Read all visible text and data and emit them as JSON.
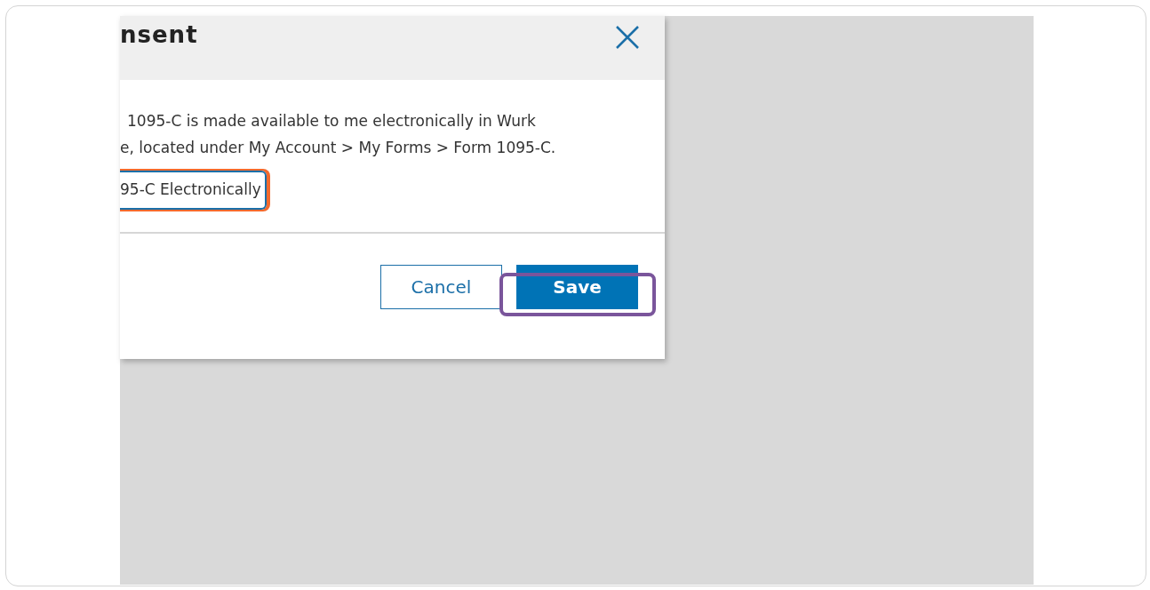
{
  "dialog": {
    "title": "nsent",
    "body_lines": [
      "1095-C is made available to me electronically in Wurk",
      "e, located under My Account > My Forms > Form 1095-C."
    ],
    "consent_button": {
      "label": "95-C Electronically",
      "focused": true
    },
    "buttons": [
      {
        "kind": "secondary",
        "label": "Cancel",
        "highlighted": false
      },
      {
        "kind": "primary",
        "label": "Save",
        "highlighted": true
      }
    ]
  }
}
